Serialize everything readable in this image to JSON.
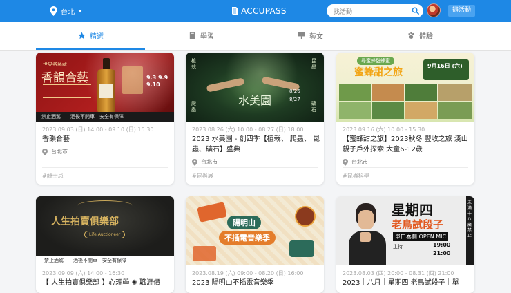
{
  "header": {
    "location": "台北",
    "brand": "ACCUPASS",
    "search_placeholder": "找活動",
    "host_button": "辦活動"
  },
  "tabs": [
    {
      "label": "精選",
      "icon": "star-icon",
      "active": true
    },
    {
      "label": "學習",
      "icon": "book-icon",
      "active": false
    },
    {
      "label": "藝文",
      "icon": "easel-icon",
      "active": false
    },
    {
      "label": "體驗",
      "icon": "paw-icon",
      "active": false
    }
  ],
  "cards": [
    {
      "date": "2023.09.03 (日) 14:00 - 09.10 (日) 15:30",
      "title": "香韻合藝",
      "place": "台北市",
      "tag": "#酬士忌",
      "poster": {
        "big": "香韻合藝",
        "top": "世界名藝藏",
        "dates": "9.3 9.9 9.10",
        "footer": "禁止酒駕　　酒後不開車　安全有保障"
      }
    },
    {
      "date": "2023.08.26 (六) 10:00 - 08.27 (日) 18:00",
      "title": "2023 水美園 - 創四季【植栽、 爬蟲、 昆蟲、礦石】盛典",
      "place": "台北市",
      "tag": "#昆蟲展",
      "poster": {
        "big": "水美園",
        "left1": "植栽",
        "left2": "爬蟲",
        "right1": "昆蟲",
        "right2": "礦石",
        "d1": "8/26",
        "d2": "8/27"
      }
    },
    {
      "date": "2023.09.16 (六) 10:00 - 15:30",
      "title": "【蜜蜂甜之旅】2023秋冬 豐收之旅 淺山親子戶外探索 大童6-12歲",
      "place": "台北市",
      "tag": "#昆蟲科學",
      "poster": {
        "top": "尋蜜蜂甜蜂蜜",
        "big": "蜜蜂甜之旅",
        "badge": "9月16日 (六)"
      }
    },
    {
      "date": "2023.09.09 (六) 14:00 - 16:30",
      "title": "【 人生拍賣俱樂部 】心理學 ✺ 職涯價",
      "poster": {
        "big": "人生拍賣俱樂部",
        "sub": "Life Auctioneer",
        "footer": "禁止酒駕　　酒後不開車　安全有保障"
      }
    },
    {
      "date": "2023.08.19 (六) 09:00 - 08.20 (日) 16:00",
      "title": "2023 陽明山不插電音樂季",
      "poster": {
        "l1": "陽明山",
        "l2": "不插電音樂季"
      }
    },
    {
      "date": "2023.08.03 (四) 20:00 - 08.31 (四) 21:00",
      "title": "2023｜八月｜星期四 老鳥試段子｜單",
      "poster": {
        "l1": "星期四",
        "l2": "老鳥試段子",
        "l3": "單口喜劇 OPEN MIC",
        "host": "主持",
        "time1": "19:00",
        "time2": "21:00",
        "side": "未滿十八歲禁止"
      }
    }
  ],
  "colors": {
    "brand_blue": "#1e88e5",
    "tag_gray": "#aaaaaa"
  }
}
